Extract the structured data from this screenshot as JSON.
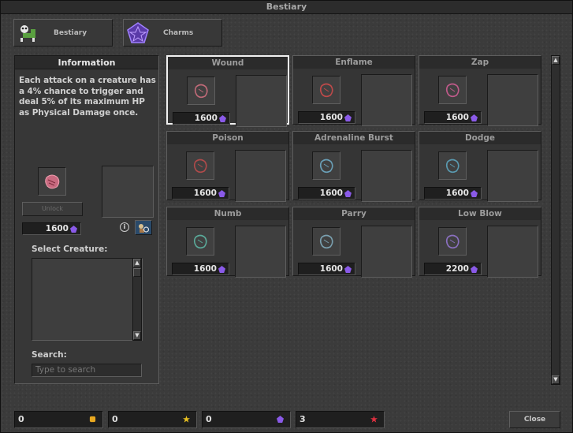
{
  "window": {
    "title": "Bestiary"
  },
  "top_tabs": [
    {
      "label": "Bestiary",
      "icon": "skeleton-creature-icon"
    },
    {
      "label": "Charms",
      "icon": "purple-pentagram-icon"
    }
  ],
  "info": {
    "header": "Information",
    "description": "Each attack on a creature has a 4% chance to trigger and deal 5% of its maximum HP as Physical Damage once.",
    "unlock_label": "Unlock",
    "price": "1600",
    "select_creature_label": "Select Creature:",
    "search_label": "Search:",
    "search_placeholder": "Type to search"
  },
  "charms": [
    {
      "name": "Wound",
      "price": "1600",
      "selected": true,
      "icon_color": "#c06a78"
    },
    {
      "name": "Enflame",
      "price": "1600",
      "selected": false,
      "icon_color": "#c04a4a"
    },
    {
      "name": "Zap",
      "price": "1600",
      "selected": false,
      "icon_color": "#c05a8a"
    },
    {
      "name": "Poison",
      "price": "1600",
      "selected": false,
      "icon_color": "#b04a4a"
    },
    {
      "name": "Adrenaline Burst",
      "price": "1600",
      "selected": false,
      "icon_color": "#6aa0b8"
    },
    {
      "name": "Dodge",
      "price": "1600",
      "selected": false,
      "icon_color": "#5a9ab0"
    },
    {
      "name": "Numb",
      "price": "1600",
      "selected": false,
      "icon_color": "#5aaa9a"
    },
    {
      "name": "Parry",
      "price": "1600",
      "selected": false,
      "icon_color": "#7aa0b0"
    },
    {
      "name": "Low Blow",
      "price": "2200",
      "selected": false,
      "icon_color": "#8a70c0"
    }
  ],
  "resources": [
    {
      "value": "0",
      "icon": "gold-coin-icon",
      "color": "#e8a820"
    },
    {
      "value": "0",
      "icon": "star-icon",
      "color": "#e8c020"
    },
    {
      "value": "0",
      "icon": "charm-point-icon",
      "color": "#8a5ae8"
    },
    {
      "value": "3",
      "icon": "red-star-icon",
      "color": "#e03040"
    }
  ],
  "close_label": "Close"
}
